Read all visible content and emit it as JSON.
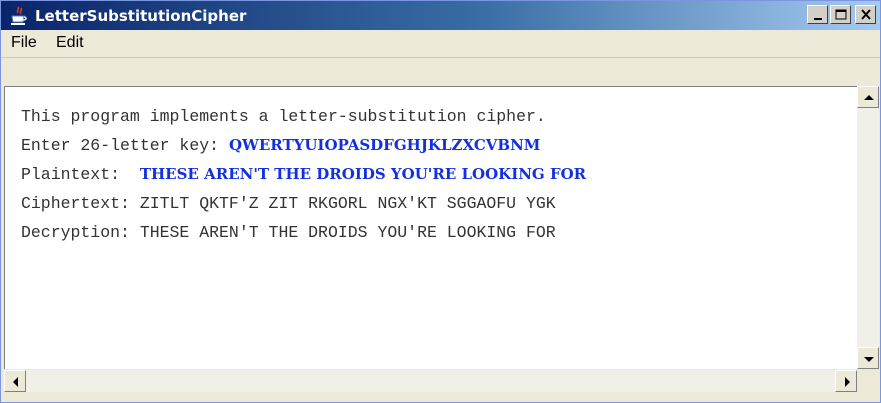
{
  "window": {
    "title": "LetterSubstitutionCipher",
    "controls": [
      "minimize-icon",
      "maximize-icon",
      "close-icon"
    ]
  },
  "menu": {
    "items": [
      {
        "label": "File"
      },
      {
        "label": "Edit"
      }
    ]
  },
  "console": {
    "line1": "This program implements a letter-substitution cipher.",
    "line2_prompt": "Enter 26-letter key: ",
    "line2_input": "QWERTYUIOPASDFGHJKLZXCVBNM",
    "line3_prompt": "Plaintext:  ",
    "line3_input": "THESE AREN'T THE DROIDS YOU'RE LOOKING FOR",
    "line4": "Ciphertext: ZITLT QKTF'Z ZIT RKGORL NGX'KT SGGAOFU YGK",
    "line5": "Decryption: THESE AREN'T THE DROIDS YOU'RE LOOKING FOR"
  },
  "colors": {
    "title_gradient_start": "#0a246a",
    "title_gradient_end": "#a6caf0",
    "input_text": "#1230e0",
    "output_text": "#333333"
  },
  "icons": {
    "app": "java-coffee-cup-icon",
    "scroll_up": "arrow-up-icon",
    "scroll_down": "arrow-down-icon",
    "scroll_left": "arrow-left-icon",
    "scroll_right": "arrow-right-icon"
  }
}
